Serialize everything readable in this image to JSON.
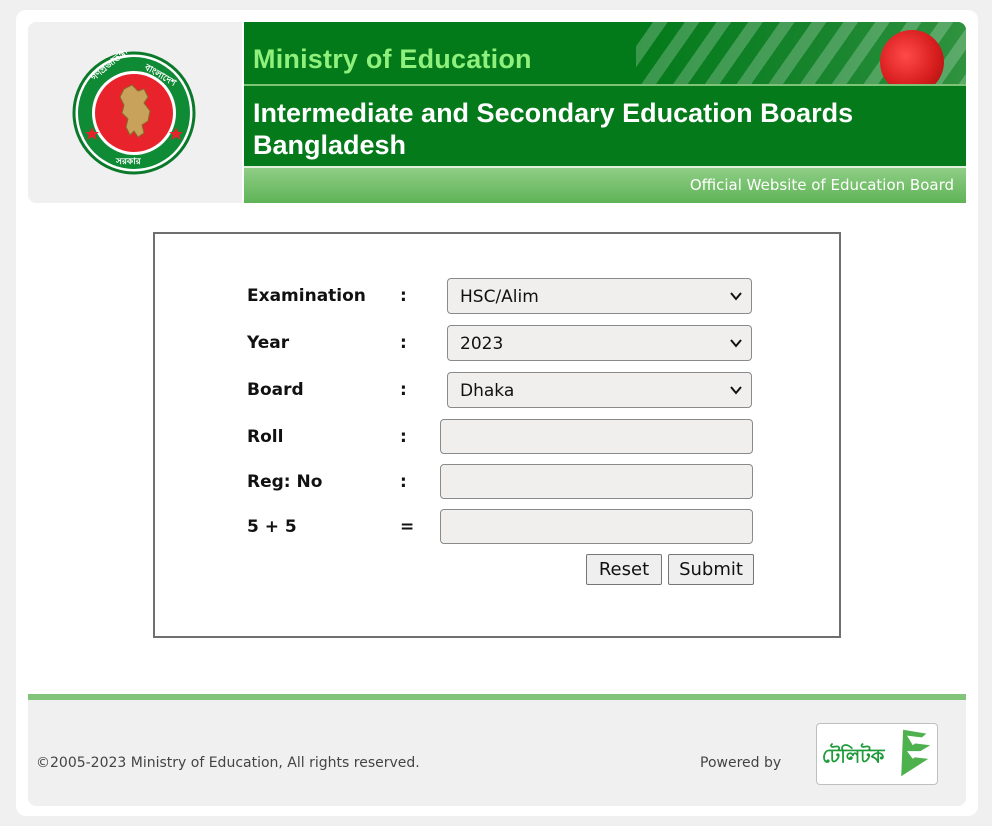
{
  "header": {
    "ministry": "Ministry of Education",
    "board_title_line1": "Intermediate and Secondary Education Boards",
    "board_title_line2": "Bangladesh",
    "tagline": "Official Website of Education Board",
    "logo_icon": "government-seal-icon",
    "colors": {
      "banner_green": "#047a1a",
      "ministry_text": "#8ff07c",
      "accent_green": "#82c57a"
    }
  },
  "form": {
    "fields": [
      {
        "label": "Examination",
        "separator": ":",
        "type": "select",
        "value": "HSC/Alim"
      },
      {
        "label": "Year",
        "separator": ":",
        "type": "select",
        "value": "2023"
      },
      {
        "label": "Board",
        "separator": ":",
        "type": "select",
        "value": "Dhaka"
      },
      {
        "label": "Roll",
        "separator": ":",
        "type": "input",
        "value": ""
      },
      {
        "label": "Reg: No",
        "separator": ":",
        "type": "input",
        "value": ""
      },
      {
        "label": "5 + 5",
        "separator": "=",
        "type": "input",
        "value": ""
      }
    ],
    "reset_label": "Reset",
    "submit_label": "Submit"
  },
  "footer": {
    "copyright": "©2005-2023 Ministry of Education, All rights reserved.",
    "powered_by": "Powered by",
    "powered_logo_icon": "teletalk-logo-icon",
    "powered_logo_text": "টেলিটক"
  }
}
